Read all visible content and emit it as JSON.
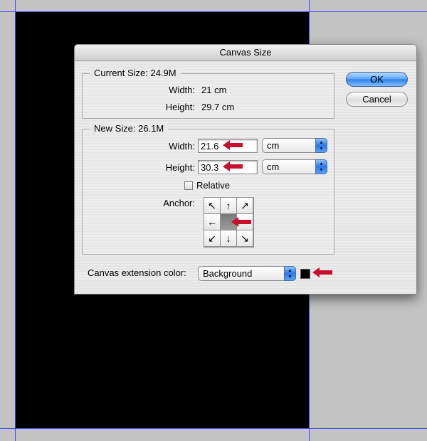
{
  "dialog": {
    "title": "Canvas Size",
    "current_size": {
      "legend": "Current Size: 24.9M",
      "width_label": "Width:",
      "width_value": "21 cm",
      "height_label": "Height:",
      "height_value": "29.7 cm"
    },
    "new_size": {
      "legend": "New Size: 26.1M",
      "width_label": "Width:",
      "width_value": "21.6",
      "width_unit": "cm",
      "height_label": "Height:",
      "height_value": "30.3",
      "height_unit": "cm",
      "relative_label": "Relative",
      "relative_checked": false,
      "anchor_label": "Anchor:",
      "anchor_selected": "center"
    },
    "extension": {
      "label": "Canvas extension color:",
      "value": "Background",
      "swatch_color": "#000000"
    },
    "buttons": {
      "ok": "OK",
      "cancel": "Cancel"
    }
  },
  "colors": {
    "annotation_arrow": "#c8102e",
    "guide_line": "#3b4cff",
    "canvas_background": "#000000"
  },
  "icons": {
    "anchor_cells": [
      "arrow-up-left-icon",
      "arrow-up-icon",
      "arrow-up-right-icon",
      "arrow-left-icon",
      "anchor-center",
      "arrow-right-icon",
      "arrow-down-left-icon",
      "arrow-down-icon",
      "arrow-down-right-icon"
    ]
  }
}
